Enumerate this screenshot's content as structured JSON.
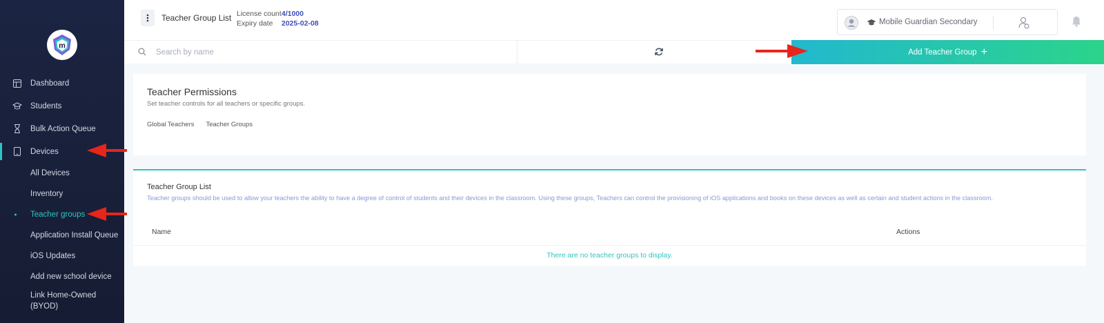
{
  "header": {
    "title": "Teacher Group List",
    "license_label": "License count",
    "license_value": "4/1000",
    "expiry_label": "Expiry date",
    "expiry_value": "2025-02-08",
    "school_name": "Mobile Guardian Secondary"
  },
  "sidebar": {
    "items": [
      {
        "label": "Dashboard",
        "icon": "dashboard-icon"
      },
      {
        "label": "Students",
        "icon": "graduation-cap-icon"
      },
      {
        "label": "Bulk Action Queue",
        "icon": "hourglass-icon"
      },
      {
        "label": "Devices",
        "icon": "tablet-icon"
      }
    ],
    "sub_items": [
      {
        "label": "All Devices"
      },
      {
        "label": "Inventory"
      },
      {
        "label": "Teacher groups"
      },
      {
        "label": "Application Install Queue"
      },
      {
        "label": "iOS Updates"
      },
      {
        "label": "Add new school device"
      },
      {
        "label": "Link Home-Owned (BYOD)"
      }
    ]
  },
  "actions": {
    "search_placeholder": "Search by name",
    "add_label": "Add Teacher Group",
    "add_plus": "+"
  },
  "permissions": {
    "title": "Teacher Permissions",
    "description": "Set teacher controls for all teachers or specific groups.",
    "tabs": [
      "Global Teachers",
      "Teacher Groups"
    ]
  },
  "group_list": {
    "title": "Teacher Group List",
    "description": "Teacher groups should be used to allow your teachers the ability to have a degree of control of students and their devices in the classroom. Using these groups, Teachers can control the provisioning of iOS applications and books on these devices as well as certain and student actions in the classroom.",
    "columns": [
      "Name",
      "Actions"
    ],
    "empty_message": "There are no teacher groups to display."
  },
  "colors": {
    "sidebar_bg": "#1b2442",
    "accent": "#2ec4c0",
    "link_value": "#3f4fb8",
    "add_gradient_start": "#22b8cf",
    "add_gradient_end": "#2bd48a",
    "annotation_arrow": "#e8251a"
  }
}
